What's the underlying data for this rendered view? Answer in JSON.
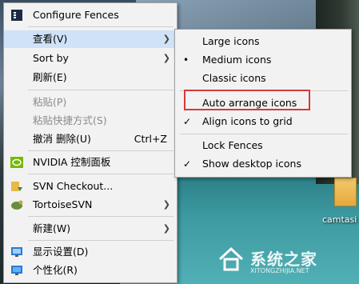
{
  "main_menu": {
    "items": [
      {
        "label": "Configure Fences",
        "icon": "fences-icon"
      },
      {
        "label": "查看(V)",
        "has_submenu": true,
        "highlighted": true
      },
      {
        "label": "Sort by",
        "has_submenu": true
      },
      {
        "label": "刷新(E)"
      },
      {
        "label": "粘贴(P)",
        "disabled": true
      },
      {
        "label": "粘贴快捷方式(S)",
        "disabled": true
      },
      {
        "label": "撤消 删除(U)",
        "shortcut": "Ctrl+Z"
      },
      {
        "label": "NVIDIA 控制面板",
        "icon": "nvidia-icon"
      },
      {
        "label": "SVN Checkout...",
        "icon": "svn-checkout-icon"
      },
      {
        "label": "TortoiseSVN",
        "icon": "tortoisesvn-icon",
        "has_submenu": true
      },
      {
        "label": "新建(W)",
        "has_submenu": true
      },
      {
        "label": "显示设置(D)",
        "icon": "display-settings-icon"
      },
      {
        "label": "个性化(R)",
        "icon": "personalize-icon"
      }
    ]
  },
  "view_submenu": {
    "items": [
      {
        "label": "Large icons"
      },
      {
        "label": "Medium icons",
        "selected": true,
        "mark": "•"
      },
      {
        "label": "Classic icons"
      },
      {
        "label": "Auto arrange icons",
        "annotated": true
      },
      {
        "label": "Align icons to grid",
        "checked": true,
        "mark": "✓"
      },
      {
        "label": "Lock Fences"
      },
      {
        "label": "Show desktop icons",
        "checked": true,
        "mark": "✓"
      }
    ]
  },
  "desktop": {
    "icon_label": "camtasi"
  },
  "watermark": {
    "title": "系统之家",
    "subtitle": "XITONGZHIJIA.NET"
  },
  "colors": {
    "annotation": "#d6393a",
    "menu_bg": "#f2f2f2",
    "hover_bg": "#cfe2f7"
  }
}
